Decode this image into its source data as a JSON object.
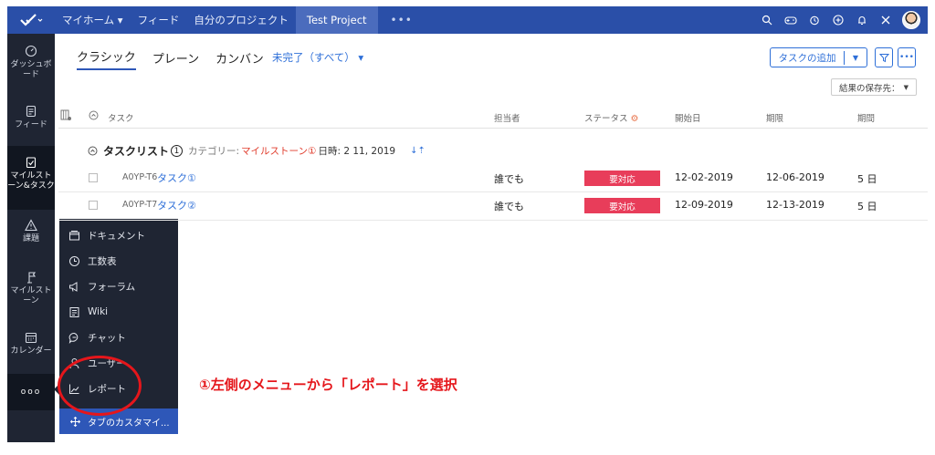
{
  "topbar": {
    "nav": [
      "マイホーム ▾",
      "フィード",
      "自分のプロジェクト"
    ],
    "active_project": "Test Project",
    "more": "•••"
  },
  "sidebar": {
    "items": [
      {
        "label": "ダッシュボード",
        "icon": "dashboard-icon"
      },
      {
        "label": "フィード",
        "icon": "feed-icon"
      },
      {
        "label": "マイルストーン&タスク",
        "icon": "milestone-task-icon"
      },
      {
        "label": "課題",
        "icon": "issue-icon"
      },
      {
        "label": "マイルストーン",
        "icon": "milestone-icon"
      },
      {
        "label": "カレンダー",
        "icon": "calendar-icon"
      }
    ],
    "more": "ooo"
  },
  "popup_menu": {
    "items": [
      {
        "label": "ドキュメント",
        "icon": "document-icon"
      },
      {
        "label": "工数表",
        "icon": "timesheet-icon"
      },
      {
        "label": "フォーラム",
        "icon": "forum-icon"
      },
      {
        "label": "Wiki",
        "icon": "wiki-icon"
      },
      {
        "label": "チャット",
        "icon": "chat-icon"
      },
      {
        "label": "ユーザー",
        "icon": "users-icon"
      },
      {
        "label": "レポート",
        "icon": "report-icon"
      }
    ],
    "customize": "タブのカスタマイ..."
  },
  "view_tabs": [
    "クラシック",
    "プレーン",
    "カンバン"
  ],
  "filter": "未完了（すべて） ▾",
  "add_task": "タスクの追加",
  "save_results": "結果の保存先：",
  "columns": {
    "task": "タスク",
    "owner": "担当者",
    "status": "ステータス",
    "start": "開始日",
    "due": "期限",
    "duration": "期間"
  },
  "tasklist": {
    "name": "タスクリスト",
    "badge": "1",
    "category_label": "カテゴリー:",
    "milestone": "マイルストーン①",
    "date": "日時: 2 11, 2019"
  },
  "rows": [
    {
      "key": "A0YP-T6",
      "name": "タスク①",
      "owner": "誰でも",
      "status": "要対応",
      "start": "12-02-2019",
      "due": "12-06-2019",
      "duration": "5 日"
    },
    {
      "key": "A0YP-T7",
      "name": "タスク②",
      "owner": "誰でも",
      "status": "要対応",
      "start": "12-09-2019",
      "due": "12-13-2019",
      "duration": "5 日"
    }
  ],
  "annotation": "①左側のメニューから「レポート」を選択",
  "colors": {
    "topbar": "#2a4fa8",
    "sidebar": "#1f2533",
    "accent": "#2e6fd8",
    "status": "#e83d5a",
    "annotation": "#e5161b"
  }
}
